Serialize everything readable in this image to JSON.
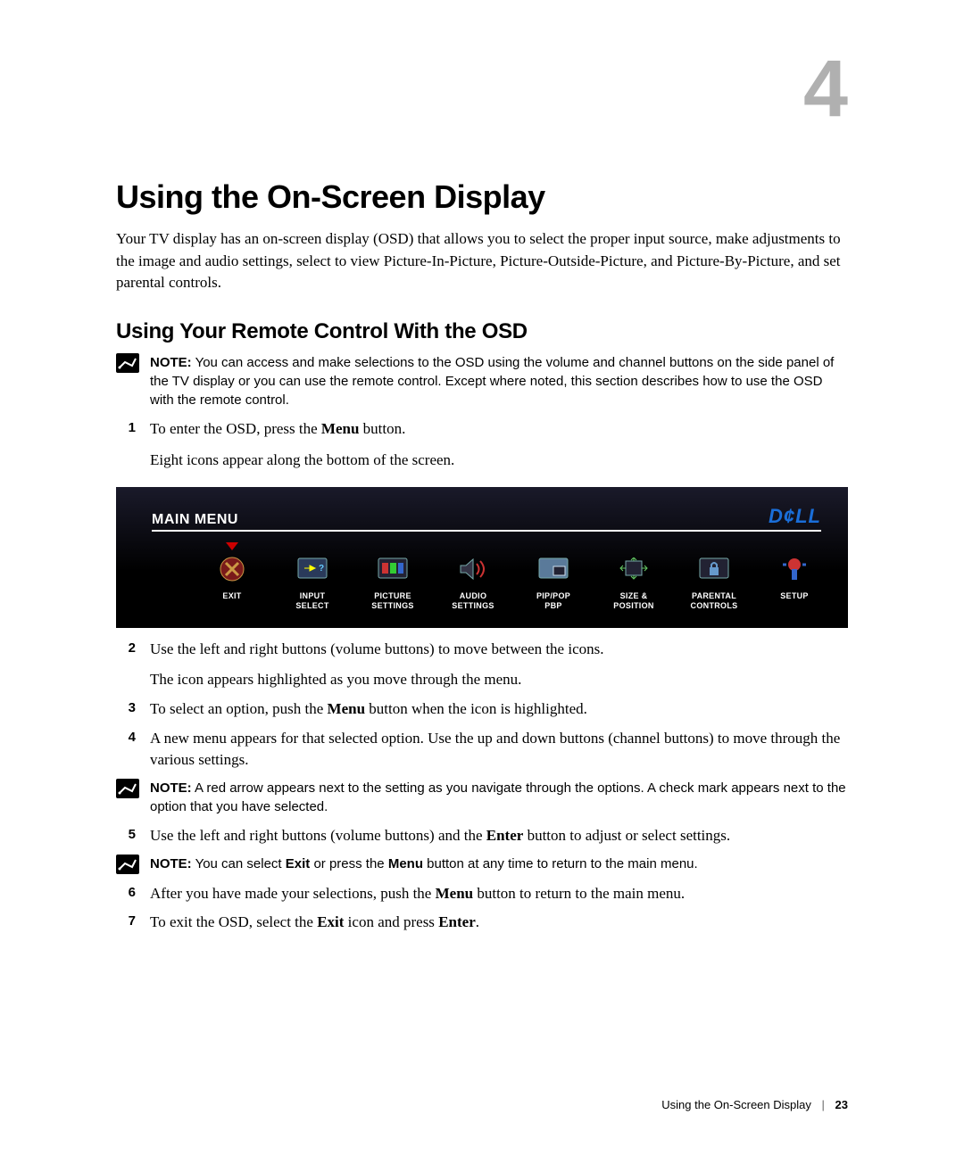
{
  "chapter_number": "4",
  "h1": "Using the On-Screen Display",
  "intro": "Your TV display has an on-screen display (OSD) that allows you to select the proper input source, make adjustments to the image and audio settings, select to view Picture-In-Picture, Picture-Outside-Picture, and Picture-By-Picture, and set parental controls.",
  "h2": "Using Your Remote Control With the OSD",
  "notes": {
    "label": "NOTE:",
    "n1": "You can access and make selections to the OSD using the volume and channel buttons on the side panel of the TV display or you can use the remote control. Except where noted, this section describes how to use the OSD with the remote control.",
    "n2": "A red arrow appears next to the setting as you navigate through the options. A check mark appears next to the option that you have selected.",
    "n3_a": "You can select ",
    "n3_b": "Exit",
    "n3_c": " or press the ",
    "n3_d": "Menu",
    "n3_e": " button at any time to return to the main menu."
  },
  "steps": {
    "s1_num": "1",
    "s1_a": "To enter the OSD, press the ",
    "s1_b": "Menu",
    "s1_c": " button.",
    "s1_sub": "Eight icons appear along the bottom of the screen.",
    "s2_num": "2",
    "s2": "Use the left and right buttons (volume buttons) to move between the icons.",
    "s2_sub": "The icon appears highlighted as you move through the menu.",
    "s3_num": "3",
    "s3_a": "To select an option, push the ",
    "s3_b": "Menu",
    "s3_c": " button when the icon is highlighted.",
    "s4_num": "4",
    "s4": "A new menu appears for that selected option. Use the up and down buttons (channel buttons) to move through the various settings.",
    "s5_num": "5",
    "s5_a": "Use the left and right buttons (volume buttons) and the ",
    "s5_b": "Enter",
    "s5_c": " button to adjust or select settings.",
    "s6_num": "6",
    "s6_a": "After you have made your selections, push the ",
    "s6_b": "Menu",
    "s6_c": " button to return to the main menu.",
    "s7_num": "7",
    "s7_a": "To exit the OSD, select the ",
    "s7_b": "Exit",
    "s7_c": " icon and press ",
    "s7_d": "Enter",
    "s7_e": "."
  },
  "osd": {
    "title": "MAIN MENU",
    "logo": "D¢LL",
    "items": [
      {
        "label": "EXIT"
      },
      {
        "label": "INPUT\nSELECT"
      },
      {
        "label": "PICTURE\nSETTINGS"
      },
      {
        "label": "AUDIO\nSETTINGS"
      },
      {
        "label": "PIP/POP\nPBP"
      },
      {
        "label": "SIZE &\nPOSITION"
      },
      {
        "label": "PARENTAL\nCONTROLS"
      },
      {
        "label": "SETUP"
      }
    ]
  },
  "footer": {
    "title": "Using the On-Screen Display",
    "page": "23"
  }
}
